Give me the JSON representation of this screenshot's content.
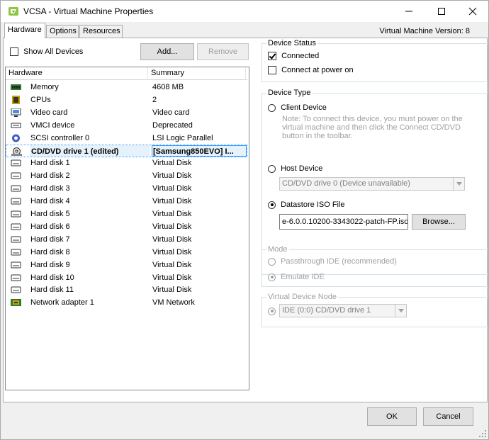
{
  "window": {
    "title": "VCSA - Virtual Machine Properties",
    "vm_version": "Virtual Machine Version: 8"
  },
  "tabs": [
    {
      "label": "Hardware",
      "active": true
    },
    {
      "label": "Options",
      "active": false
    },
    {
      "label": "Resources",
      "active": false
    }
  ],
  "hardware": {
    "show_all_devices_label": "Show All Devices",
    "show_all_devices_checked": false,
    "add_label": "Add...",
    "remove_label": "Remove",
    "columns": [
      "Hardware",
      "Summary"
    ],
    "devices": [
      {
        "icon": "memory-icon",
        "name": "Memory",
        "summary": "4608 MB"
      },
      {
        "icon": "cpu-icon",
        "name": "CPUs",
        "summary": "2"
      },
      {
        "icon": "video-card-icon",
        "name": "Video card",
        "summary": "Video card"
      },
      {
        "icon": "vmci-device-icon",
        "name": "VMCI device",
        "summary": "Deprecated"
      },
      {
        "icon": "scsi-controller-icon",
        "name": "SCSI controller 0",
        "summary": "LSI Logic Parallel"
      },
      {
        "icon": "cd-dvd-drive-icon",
        "name": "CD/DVD drive 1 (edited)",
        "summary": "[Samsung850EVO] I...",
        "selected": true
      },
      {
        "icon": "hard-disk-icon",
        "name": "Hard disk 1",
        "summary": "Virtual Disk"
      },
      {
        "icon": "hard-disk-icon",
        "name": "Hard disk 2",
        "summary": "Virtual Disk"
      },
      {
        "icon": "hard-disk-icon",
        "name": "Hard disk 3",
        "summary": "Virtual Disk"
      },
      {
        "icon": "hard-disk-icon",
        "name": "Hard disk 4",
        "summary": "Virtual Disk"
      },
      {
        "icon": "hard-disk-icon",
        "name": "Hard disk 5",
        "summary": "Virtual Disk"
      },
      {
        "icon": "hard-disk-icon",
        "name": "Hard disk 6",
        "summary": "Virtual Disk"
      },
      {
        "icon": "hard-disk-icon",
        "name": "Hard disk 7",
        "summary": "Virtual Disk"
      },
      {
        "icon": "hard-disk-icon",
        "name": "Hard disk 8",
        "summary": "Virtual Disk"
      },
      {
        "icon": "hard-disk-icon",
        "name": "Hard disk 9",
        "summary": "Virtual Disk"
      },
      {
        "icon": "hard-disk-icon",
        "name": "Hard disk 10",
        "summary": "Virtual Disk"
      },
      {
        "icon": "hard-disk-icon",
        "name": "Hard disk 11",
        "summary": "Virtual Disk"
      },
      {
        "icon": "network-adapter-icon",
        "name": "Network adapter 1",
        "summary": "VM Network"
      }
    ]
  },
  "device_status": {
    "title": "Device Status",
    "connected_label": "Connected",
    "connected_checked": true,
    "connect_at_power_on_label": "Connect at power on",
    "connect_at_power_on_checked": false
  },
  "device_type": {
    "title": "Device Type",
    "client_device_label": "Client Device",
    "client_device_note": "Note: To connect this device, you must power on the virtual machine and then click the Connect CD/DVD button in the toolbar.",
    "host_device_label": "Host Device",
    "host_device_select": "CD/DVD drive 0 (Device unavailable)",
    "datastore_iso_label": "Datastore ISO File",
    "datastore_iso_value": "e-6.0.0.10200-3343022-patch-FP.iso",
    "browse_label": "Browse...",
    "selected": "datastore_iso"
  },
  "mode": {
    "title": "Mode",
    "passthrough_label": "Passthrough IDE (recommended)",
    "emulate_label": "Emulate IDE"
  },
  "virtual_device_node": {
    "title": "Virtual Device Node",
    "select_value": "IDE (0:0) CD/DVD drive 1"
  },
  "footer": {
    "ok_label": "OK",
    "cancel_label": "Cancel"
  }
}
